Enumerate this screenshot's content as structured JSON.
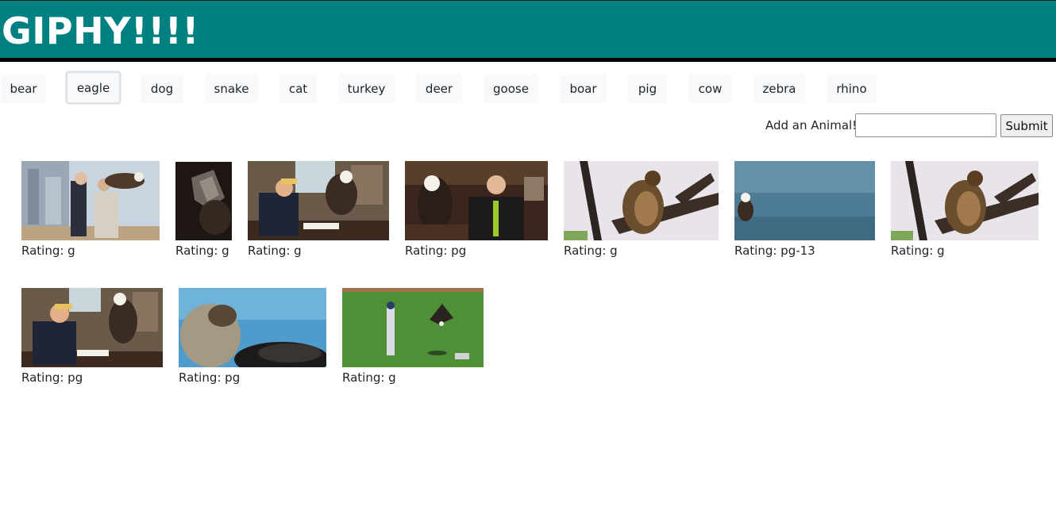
{
  "header": {
    "title": "GIPHY!!!!"
  },
  "animal_buttons": [
    "bear",
    "eagle",
    "dog",
    "snake",
    "cat",
    "turkey",
    "deer",
    "goose",
    "boar",
    "pig",
    "cow",
    "zebra",
    "rhino"
  ],
  "active_animal": "eagle",
  "add_form": {
    "label": "Add an Animal!",
    "input_value": "",
    "submit_label": "Submit"
  },
  "gifs": [
    {
      "rating": "Rating: g",
      "scene": "office-window-eagle"
    },
    {
      "rating": "Rating: g",
      "scene": "dark-rock"
    },
    {
      "rating": "Rating: g",
      "scene": "desk-eagle"
    },
    {
      "rating": "Rating: pg",
      "scene": "restaurant-eagle"
    },
    {
      "rating": "Rating: g",
      "scene": "hawk-branch"
    },
    {
      "rating": "Rating: pg-13",
      "scene": "eagle-water"
    },
    {
      "rating": "Rating: g",
      "scene": "hawk-branch-2"
    },
    {
      "rating": "Rating: pg",
      "scene": "desk-eagle-2"
    },
    {
      "rating": "Rating: pg",
      "scene": "eagle-closeup"
    },
    {
      "rating": "Rating: g",
      "scene": "baseball-field-eagle"
    }
  ]
}
